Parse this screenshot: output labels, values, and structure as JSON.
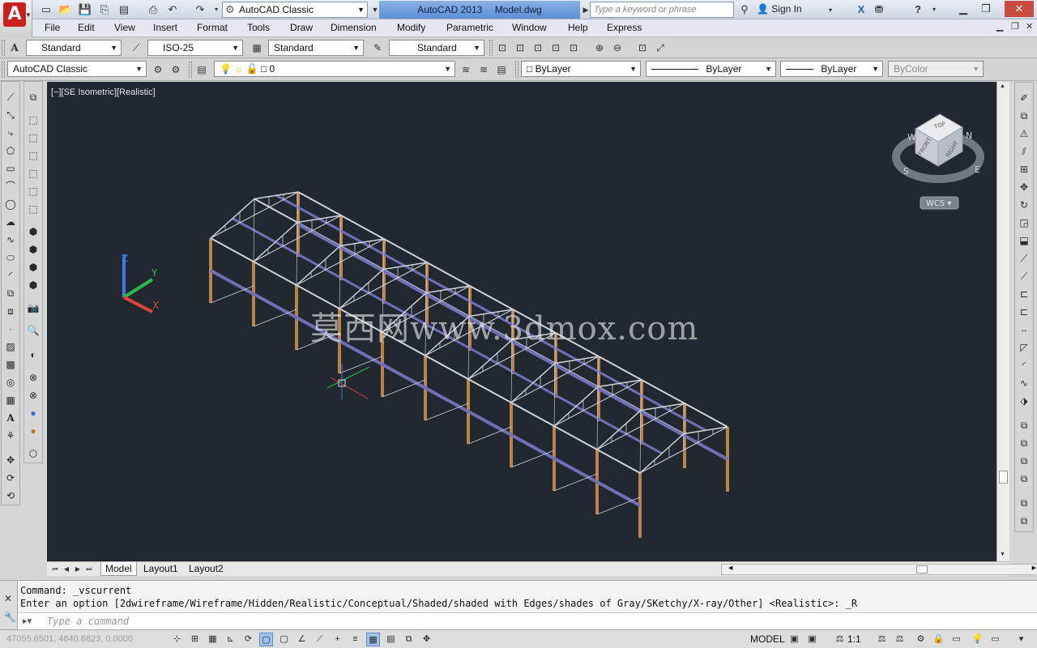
{
  "titlebar": {
    "workspace": "AutoCAD Classic",
    "app_name": "AutoCAD 2013",
    "file_name": "Model.dwg",
    "search_placeholder": "Type a keyword or phrase",
    "sign_in": "Sign In"
  },
  "menu": [
    "File",
    "Edit",
    "View",
    "Insert",
    "Format",
    "Tools",
    "Draw",
    "Dimension",
    "Modify",
    "Parametric",
    "Window",
    "Help",
    "Express"
  ],
  "styles_toolbar": {
    "text_style": "Standard",
    "dim_style": "ISO-25",
    "table_style": "Standard",
    "mleader_style": "Standard"
  },
  "layers_toolbar": {
    "workspace": "AutoCAD Classic",
    "layer": "0",
    "color": "ByLayer",
    "linetype": "ByLayer",
    "lineweight": "ByLayer",
    "plotstyle": "ByColor"
  },
  "viewport": {
    "label": "[−][SE Isometric][Realistic]",
    "viewcube": {
      "top": "TOP",
      "front": "FRONT",
      "right": "RIGHT",
      "compass": [
        "W",
        "N",
        "S",
        "E"
      ],
      "wcs": "WCS ▾"
    },
    "ucs": {
      "x": "X",
      "y": "Y",
      "z": "Z"
    },
    "watermark": "莫西网www.3dmox.com"
  },
  "layout_tabs": [
    {
      "label": "Model",
      "active": true
    },
    {
      "label": "Layout1",
      "active": false
    },
    {
      "label": "Layout2",
      "active": false
    }
  ],
  "command": {
    "history": [
      "Command: _vscurrent",
      "Enter an option [2dwireframe/Wireframe/Hidden/Realistic/Conceptual/Shaded/shaded with Edges/shades of Gray/SKetchy/X-ray/Other] <Realistic>: _R"
    ],
    "placeholder": "Type a command"
  },
  "status": {
    "coords": "47055.6501, 4840.6823, 0.0000",
    "space": "MODEL",
    "annotation_scale": "1:1"
  },
  "colors": {
    "viewport_bg": "#212830",
    "steel": "#cfd3d8",
    "column": "#b9834a",
    "purlin": "#6f6fb6"
  }
}
